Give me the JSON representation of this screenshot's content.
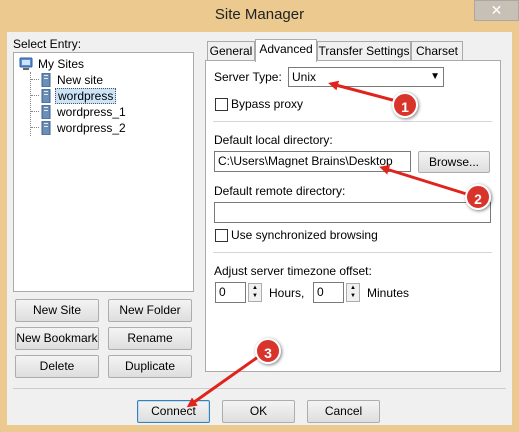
{
  "window": {
    "title": "Site Manager",
    "close_glyph": "✕"
  },
  "tree": {
    "label": "Select Entry:",
    "root": "My Sites",
    "items": [
      "New site",
      "wordpress",
      "wordpress_1",
      "wordpress_2"
    ],
    "selected": "wordpress"
  },
  "left_buttons": {
    "new_site": "New Site",
    "new_folder": "New Folder",
    "new_bookmark": "New Bookmark",
    "rename": "Rename",
    "delete": "Delete",
    "duplicate": "Duplicate"
  },
  "tabs": [
    "General",
    "Advanced",
    "Transfer Settings",
    "Charset"
  ],
  "active_tab": "Advanced",
  "advanced": {
    "server_type_label": "Server Type:",
    "server_type_value": "Unix",
    "bypass_proxy_label": "Bypass proxy",
    "bypass_proxy_checked": false,
    "local_dir_label": "Default local directory:",
    "local_dir_value": "C:\\Users\\Magnet Brains\\Desktop",
    "browse_label": "Browse...",
    "remote_dir_label": "Default remote directory:",
    "remote_dir_value": "",
    "sync_browsing_label": "Use synchronized browsing",
    "sync_browsing_checked": false,
    "timezone_label": "Adjust server timezone offset:",
    "hours_value": "0",
    "hours_label": "Hours,",
    "minutes_value": "0",
    "minutes_label": "Minutes"
  },
  "footer_buttons": {
    "connect": "Connect",
    "ok": "OK",
    "cancel": "Cancel"
  },
  "annotations": [
    "1",
    "2",
    "3"
  ],
  "colors": {
    "annotation_red": "#e0241b",
    "title_bg": "#ecc98f",
    "dialog_bg": "#f0f0f0"
  }
}
